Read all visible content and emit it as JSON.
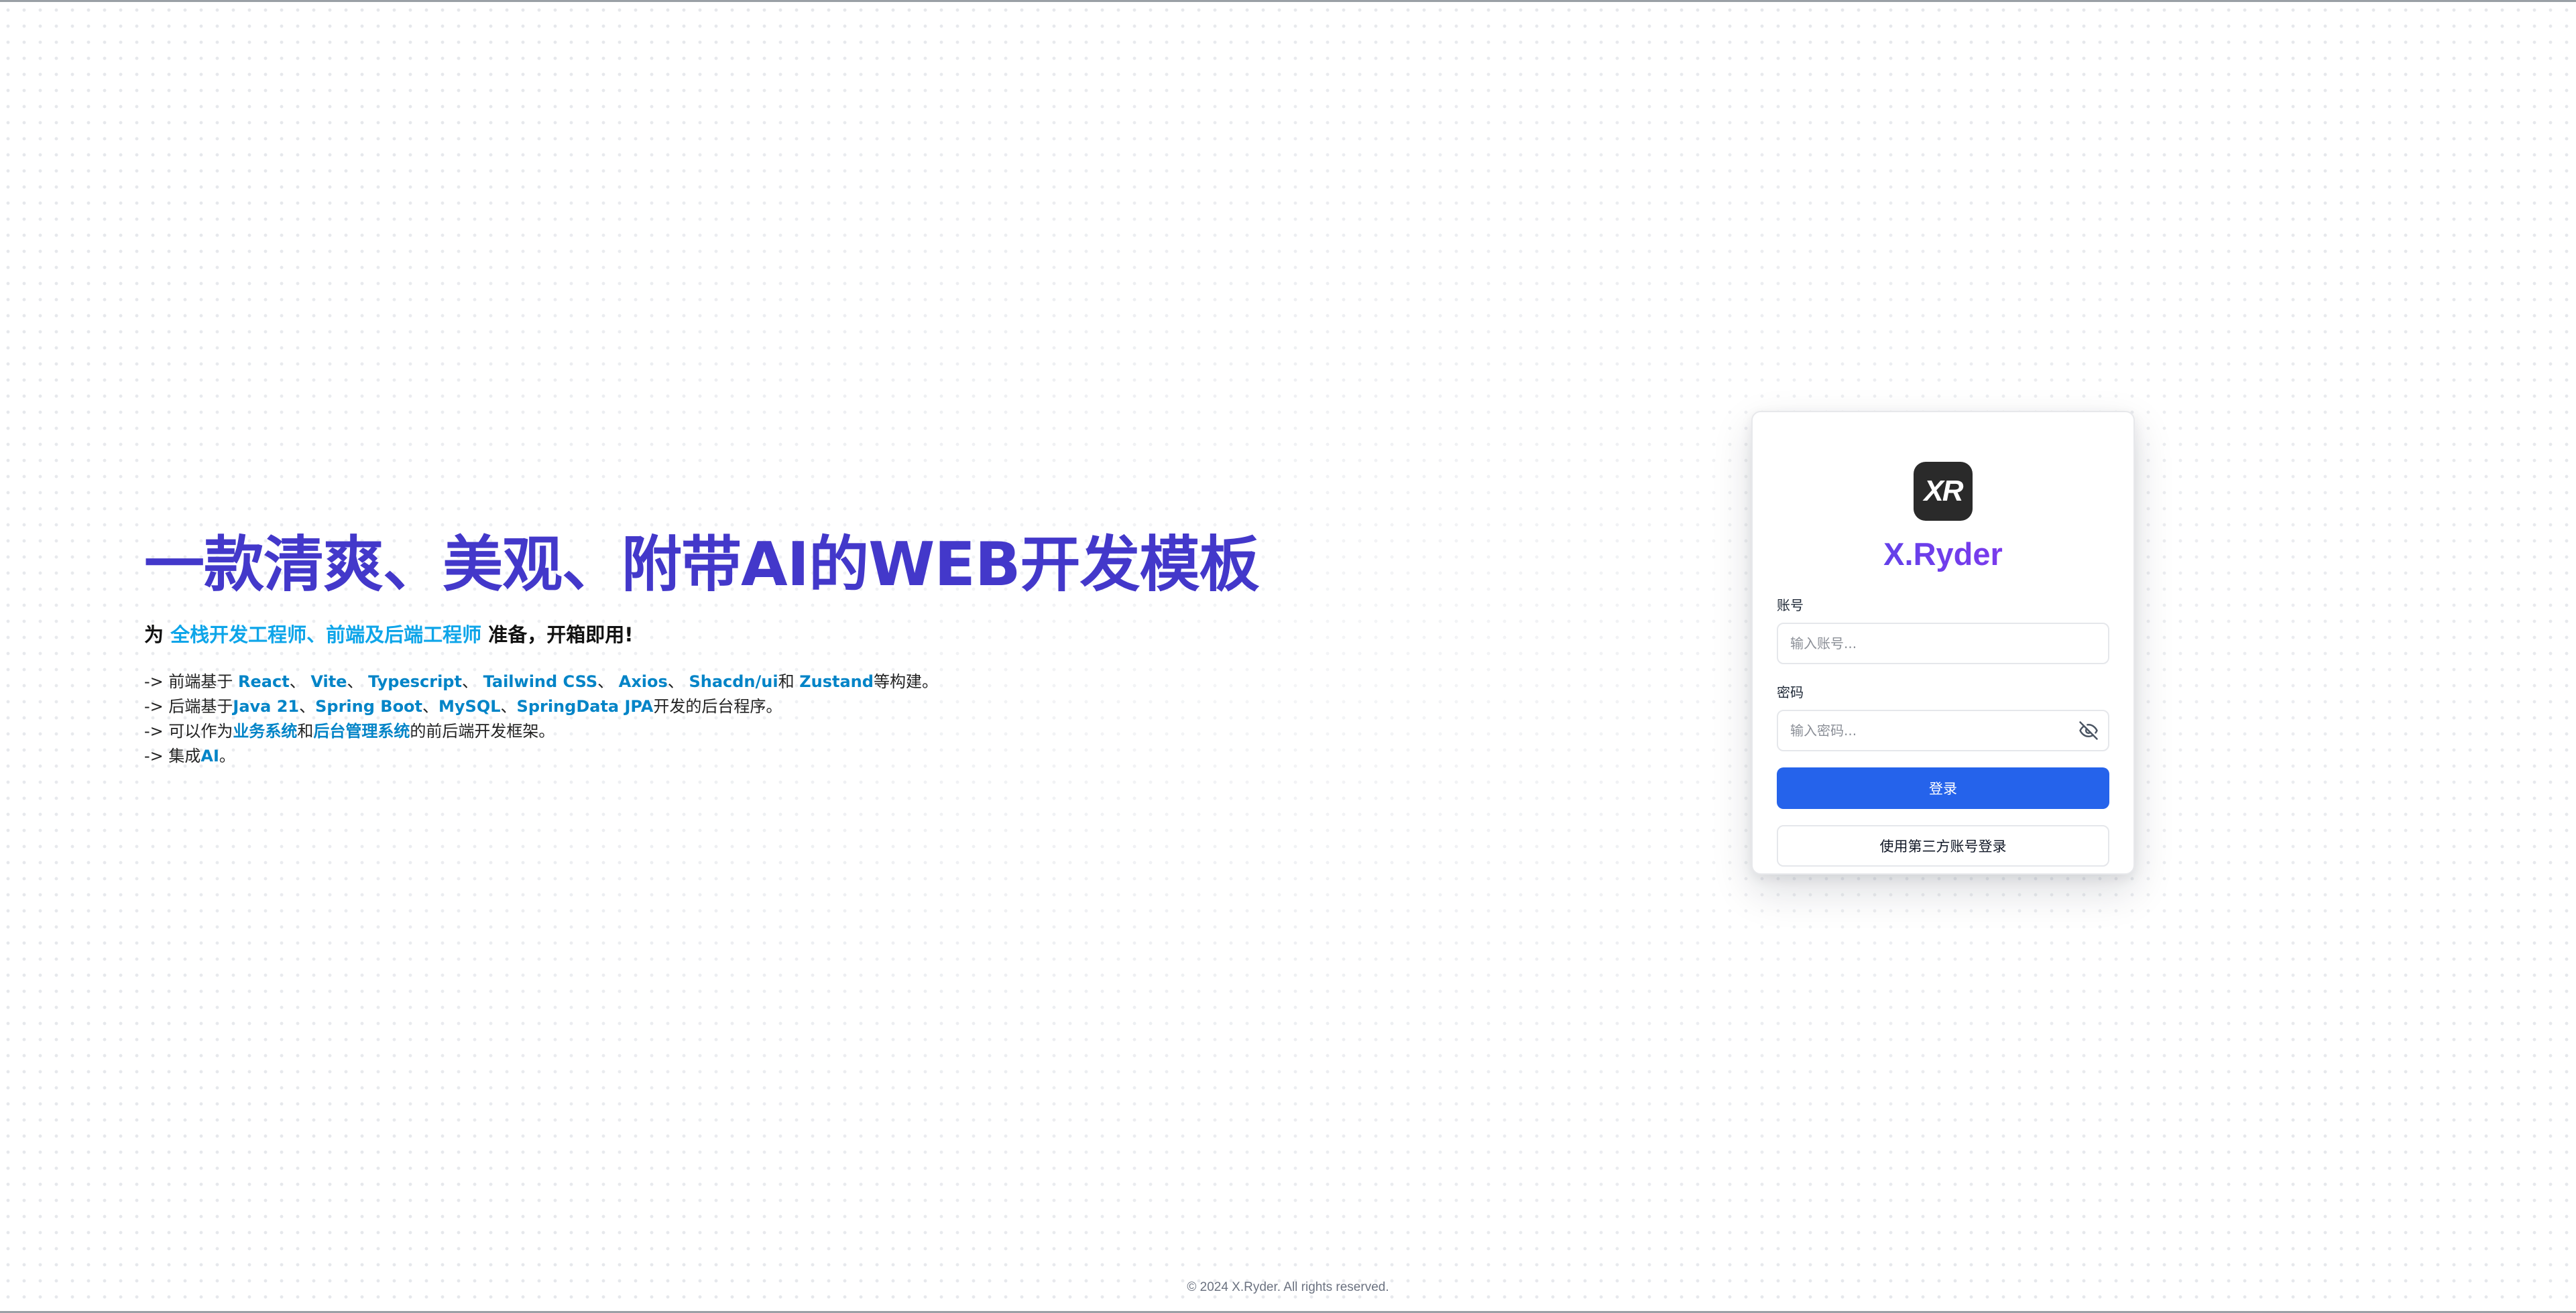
{
  "hero": {
    "title": "一款清爽、美观、附带AI的WEB开发模板",
    "subtitle": {
      "prefix": "为 ",
      "highlight": "全栈开发工程师、前端及后端工程师",
      "suffix": " 准备，开箱即用!"
    },
    "features": [
      {
        "segments": [
          {
            "text": "-> 前端基于 ",
            "hl": false
          },
          {
            "text": "React",
            "hl": true
          },
          {
            "text": "、 ",
            "hl": false
          },
          {
            "text": "Vite",
            "hl": true
          },
          {
            "text": "、 ",
            "hl": false
          },
          {
            "text": "Typescript",
            "hl": true
          },
          {
            "text": "、 ",
            "hl": false
          },
          {
            "text": "Tailwind CSS",
            "hl": true
          },
          {
            "text": "、 ",
            "hl": false
          },
          {
            "text": "Axios",
            "hl": true
          },
          {
            "text": "、 ",
            "hl": false
          },
          {
            "text": "Shacdn/ui",
            "hl": true
          },
          {
            "text": "和 ",
            "hl": false
          },
          {
            "text": "Zustand",
            "hl": true
          },
          {
            "text": "等构建。",
            "hl": false
          }
        ]
      },
      {
        "segments": [
          {
            "text": "-> 后端基于",
            "hl": false
          },
          {
            "text": "Java 21",
            "hl": true
          },
          {
            "text": "、",
            "hl": false
          },
          {
            "text": "Spring Boot",
            "hl": true
          },
          {
            "text": "、",
            "hl": false
          },
          {
            "text": "MySQL",
            "hl": true
          },
          {
            "text": "、",
            "hl": false
          },
          {
            "text": "SpringData JPA",
            "hl": true
          },
          {
            "text": "开发的后台程序。",
            "hl": false
          }
        ]
      },
      {
        "segments": [
          {
            "text": "-> 可以作为",
            "hl": false
          },
          {
            "text": "业务系统",
            "hl": true
          },
          {
            "text": "和",
            "hl": false
          },
          {
            "text": "后台管理系统",
            "hl": true
          },
          {
            "text": "的前后端开发框架。",
            "hl": false
          }
        ]
      },
      {
        "segments": [
          {
            "text": "-> 集成",
            "hl": false
          },
          {
            "text": "AI",
            "hl": true
          },
          {
            "text": "。",
            "hl": false
          }
        ]
      }
    ]
  },
  "login": {
    "logo_text": "XR",
    "brand": "X.Ryder",
    "account_label": "账号",
    "account_placeholder": "输入账号...",
    "account_value": "",
    "password_label": "密码",
    "password_placeholder": "输入密码...",
    "password_value": "",
    "password_toggle_icon": "eye-off-icon",
    "submit_label": "登录",
    "third_party_label": "使用第三方账号登录"
  },
  "footer": {
    "copyright": "© 2024 X.Ryder. All rights reserved."
  },
  "colors": {
    "title": "#4338ca",
    "highlight": "#0ea5e9",
    "primary_button": "#2563eb",
    "brand_gradient_start": "#4f46e5",
    "brand_gradient_end": "#a855f7"
  }
}
